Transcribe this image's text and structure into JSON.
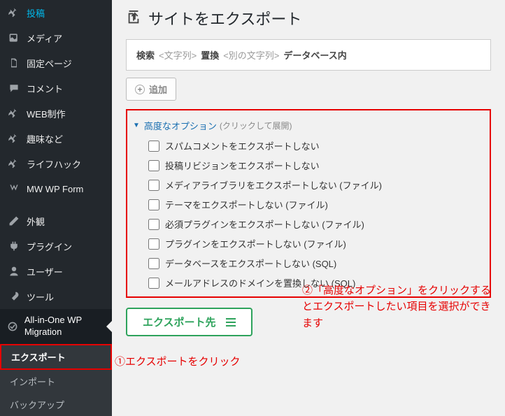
{
  "sidebar": {
    "items": [
      {
        "label": "投稿",
        "icon": "pin"
      },
      {
        "label": "メディア",
        "icon": "media"
      },
      {
        "label": "固定ページ",
        "icon": "page"
      },
      {
        "label": "コメント",
        "icon": "comment"
      },
      {
        "label": "WEB制作",
        "icon": "pin"
      },
      {
        "label": "趣味など",
        "icon": "pin"
      },
      {
        "label": "ライフハック",
        "icon": "pin"
      },
      {
        "label": "MW WP Form",
        "icon": "form"
      },
      {
        "label": "外観",
        "icon": "brush"
      },
      {
        "label": "プラグイン",
        "icon": "plugin"
      },
      {
        "label": "ユーザー",
        "icon": "user"
      },
      {
        "label": "ツール",
        "icon": "tool"
      },
      {
        "label": "All-in-One WP Migration",
        "icon": "migration"
      }
    ],
    "submenu": [
      "エクスポート",
      "インポート",
      "バックアップ"
    ]
  },
  "page": {
    "title": "サイトをエクスポート"
  },
  "search": {
    "label_find": "検索",
    "ph_find": "<文字列>",
    "label_replace": "置換",
    "ph_replace": "<別の文字列>",
    "label_in": "データベース内"
  },
  "add_btn": "追加",
  "adv": {
    "title": "高度なオプション",
    "hint": "(クリックして展開)",
    "options": [
      "スパムコメントをエクスポートしない",
      "投稿リビジョンをエクスポートしない",
      "メディアライブラリをエクスポートしない (ファイル)",
      "テーマをエクスポートしない (ファイル)",
      "必須プラグインをエクスポートしない (ファイル)",
      "プラグインをエクスポートしない (ファイル)",
      "データベースをエクスポートしない (SQL)",
      "メールアドレスのドメインを置換しない (SQL)"
    ]
  },
  "export_btn": "エクスポート先",
  "annotations": {
    "a1": "①エクスポートをクリック",
    "a2": "②「高度なオプション」をクリックするとエクスポートしたい項目を選択ができます"
  }
}
